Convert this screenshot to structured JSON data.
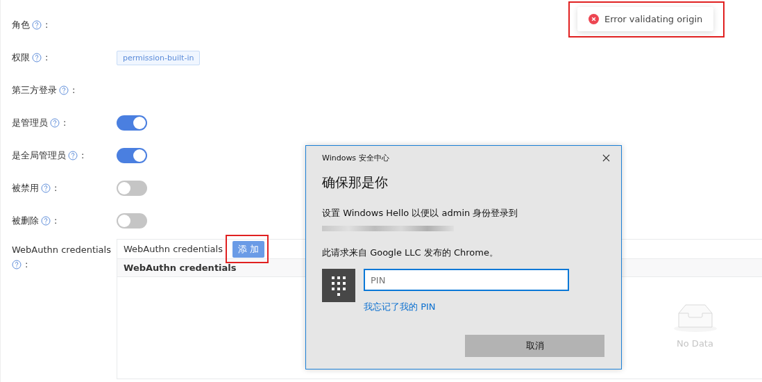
{
  "fields": [
    {
      "label": "角色",
      "suffix": ":",
      "kind": "empty"
    },
    {
      "label": "权限",
      "suffix": ":",
      "kind": "tag",
      "tag": "permission-built-in"
    },
    {
      "label": "第三方登录",
      "suffix": ":",
      "kind": "empty"
    },
    {
      "label": "是管理员",
      "suffix": ":",
      "kind": "switch",
      "on": true
    },
    {
      "label": "是全局管理员",
      "suffix": ":",
      "kind": "switch",
      "on": true
    },
    {
      "label": "被禁用",
      "suffix": ":",
      "kind": "switch",
      "on": false
    },
    {
      "label": "被删除",
      "suffix": ":",
      "kind": "switch",
      "on": false
    }
  ],
  "webauthn": {
    "label": "WebAuthn credentials",
    "suffix": ":",
    "title": "WebAuthn credentials",
    "add_button": {
      "label": "添 加",
      "highlighted": true
    },
    "columns": [
      "WebAuthn credentials"
    ],
    "empty_text": "No Data"
  },
  "toast": {
    "kind": "error",
    "message": "Error validating origin",
    "highlighted": true
  },
  "dialog": {
    "title": "Windows 安全中心",
    "heading": "确保那是你",
    "message": "设置 Windows Hello 以便以 admin 身份登录到",
    "source": "此请求来自 Google LLC 发布的 Chrome。",
    "pin": {
      "placeholder": "PIN"
    },
    "forgot_link": "我忘记了我的 PIN",
    "cancel_button": "取消"
  }
}
